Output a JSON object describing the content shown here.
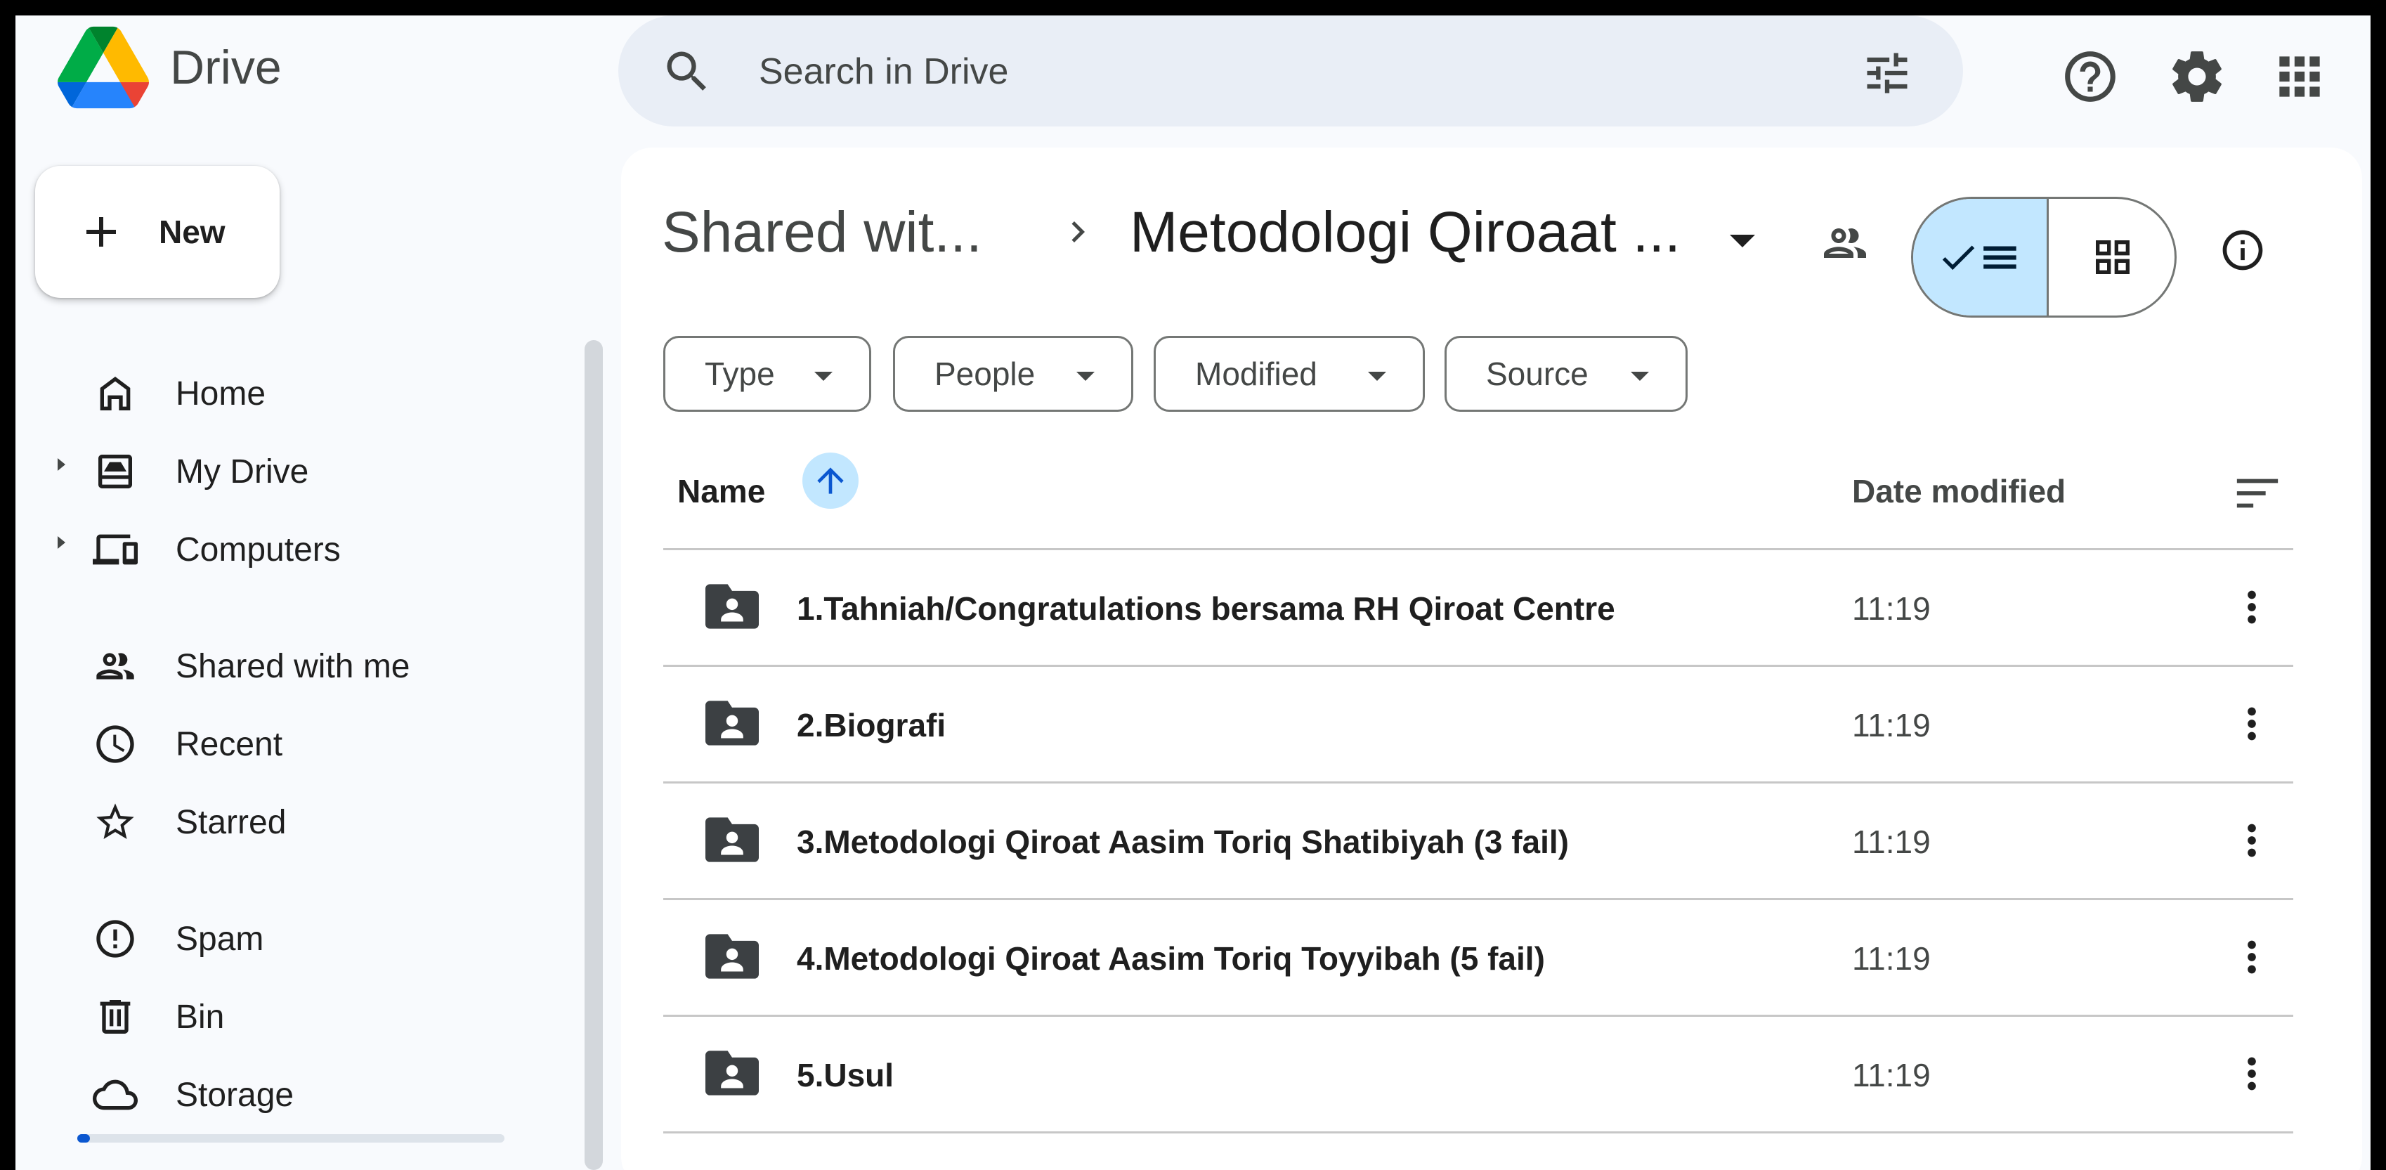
{
  "app": {
    "name": "Drive"
  },
  "search": {
    "placeholder": "Search in Drive"
  },
  "sidebar": {
    "new_label": "New",
    "items": [
      {
        "label": "Home"
      },
      {
        "label": "My Drive"
      },
      {
        "label": "Computers"
      },
      {
        "label": "Shared with me"
      },
      {
        "label": "Recent"
      },
      {
        "label": "Starred"
      },
      {
        "label": "Spam"
      },
      {
        "label": "Bin"
      },
      {
        "label": "Storage"
      }
    ],
    "storage_used_fraction": 0.03
  },
  "breadcrumb": {
    "parent": "Shared wit...",
    "current": "Metodologi Qiroaat ..."
  },
  "filters": [
    {
      "label": "Type"
    },
    {
      "label": "People"
    },
    {
      "label": "Modified"
    },
    {
      "label": "Source"
    }
  ],
  "columns": {
    "name": "Name",
    "date": "Date modified"
  },
  "files": [
    {
      "name": "1.Tahniah/Congratulations bersama RH Qiroat Centre",
      "modified": "11:19"
    },
    {
      "name": "2.Biografi",
      "modified": "11:19"
    },
    {
      "name": "3.Metodologi Qiroat Aasim Toriq Shatibiyah (3 fail)",
      "modified": "11:19"
    },
    {
      "name": "4.Metodologi Qiroat Aasim Toriq Toyyibah (5 fail)",
      "modified": "11:19"
    },
    {
      "name": "5.Usul",
      "modified": "11:19"
    }
  ],
  "colors": {
    "accent": "#0b57d0",
    "selected": "#c2e7ff",
    "search_bg": "#e9eef6"
  }
}
